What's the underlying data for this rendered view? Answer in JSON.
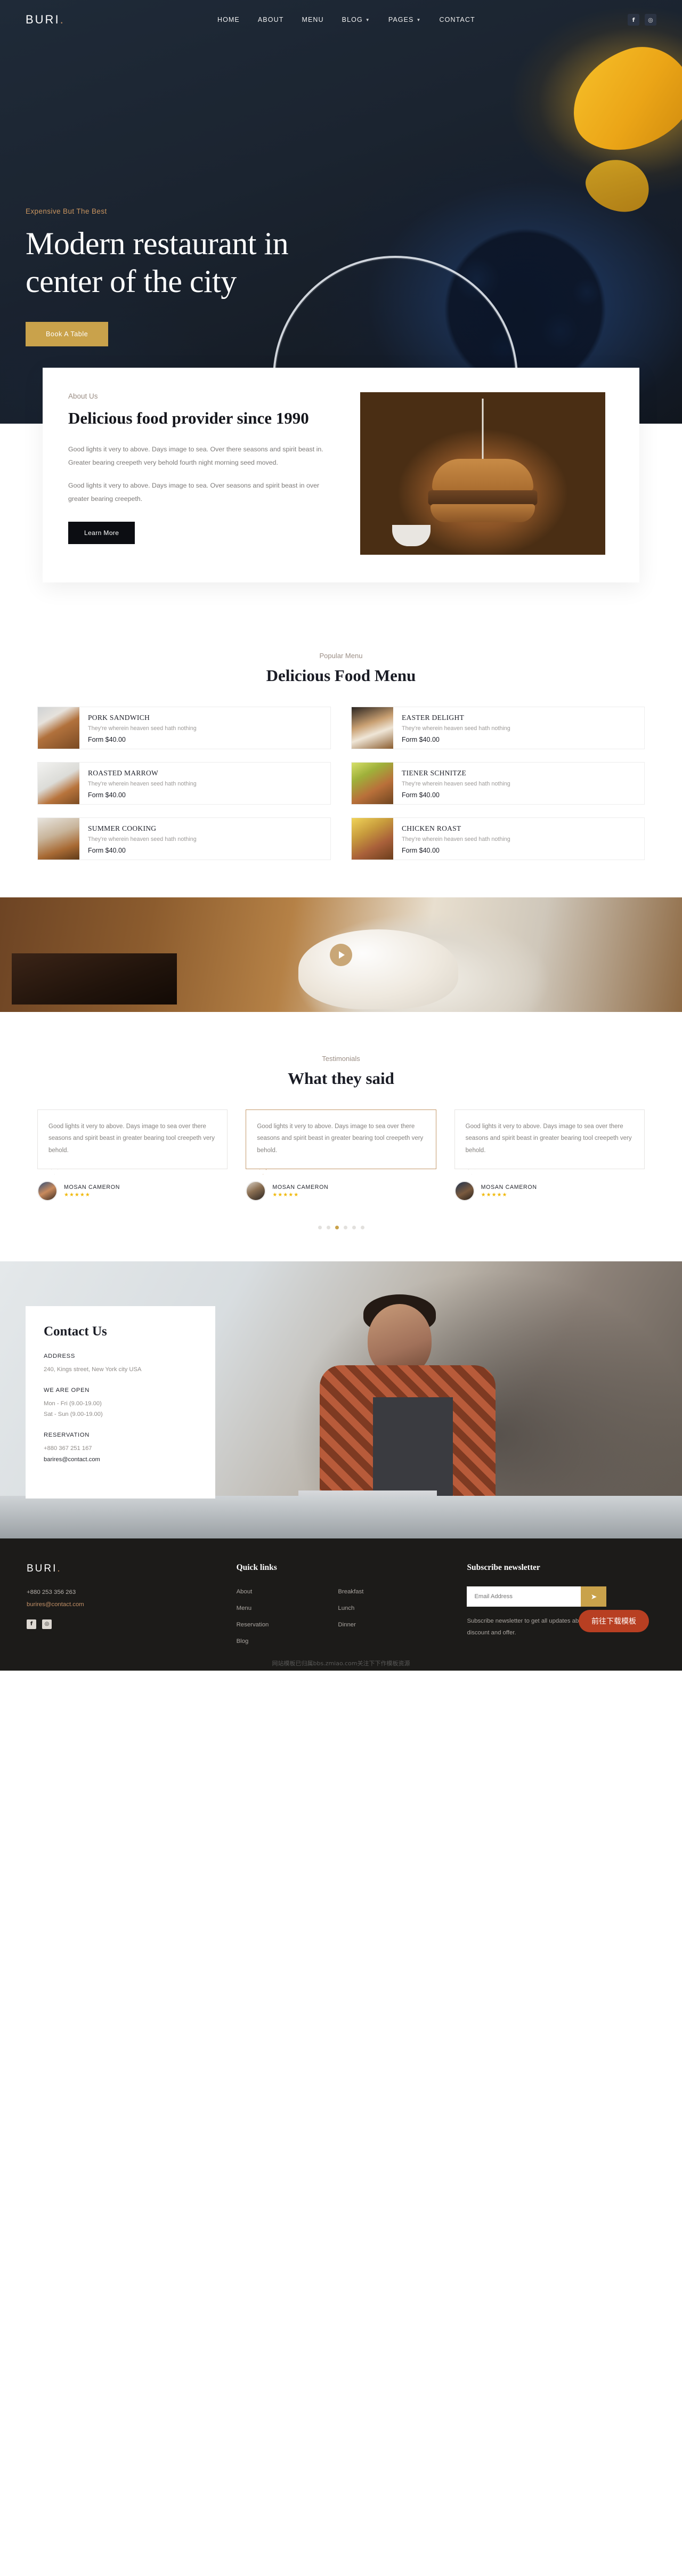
{
  "brand": {
    "name": "BURI",
    "dot": "."
  },
  "nav": {
    "items": [
      {
        "label": "HOME",
        "caret": false
      },
      {
        "label": "ABOUT",
        "caret": false
      },
      {
        "label": "MENU",
        "caret": false
      },
      {
        "label": "BLOG",
        "caret": true
      },
      {
        "label": "PAGES",
        "caret": true
      },
      {
        "label": "CONTACT",
        "caret": false
      }
    ],
    "social": [
      {
        "name": "facebook-icon",
        "glyph": "f"
      },
      {
        "name": "instagram-icon",
        "glyph": "◎"
      }
    ]
  },
  "hero": {
    "eyebrow": "Expensive But The Best",
    "title": "Modern restaurant in center of the city",
    "cta": "Book A Table"
  },
  "about": {
    "eyebrow": "About Us",
    "title": "Delicious food provider since 1990",
    "paragraph1": "Good lights it very to above. Days image to sea. Over there seasons and spirit beast in. Greater bearing creepeth very behold fourth night morning seed moved.",
    "paragraph2": "Good lights it very to above. Days image to sea. Over seasons and spirit beast in over greater bearing creepeth.",
    "cta": "Learn More"
  },
  "menu": {
    "eyebrow": "Popular Menu",
    "title": "Delicious Food Menu",
    "items": [
      {
        "name": "PORK SANDWICH",
        "desc": "They're wherein heaven seed hath nothing",
        "price": "Form $40.00"
      },
      {
        "name": "EASTER DELIGHT",
        "desc": "They're wherein heaven seed hath nothing",
        "price": "Form $40.00"
      },
      {
        "name": "ROASTED MARROW",
        "desc": "They're wherein heaven seed hath nothing",
        "price": "Form $40.00"
      },
      {
        "name": "TIENER SCHNITZE",
        "desc": "They're wherein heaven seed hath nothing",
        "price": "Form $40.00"
      },
      {
        "name": "SUMMER COOKING",
        "desc": "They're wherein heaven seed hath nothing",
        "price": "Form $40.00"
      },
      {
        "name": "CHICKEN ROAST",
        "desc": "They're wherein heaven seed hath nothing",
        "price": "Form $40.00"
      }
    ]
  },
  "video": {
    "play_label": "play-video"
  },
  "testimonials": {
    "eyebrow": "Testimonials",
    "title": "What they said",
    "cards": [
      {
        "text": "Good lights it very to above. Days image to sea over there seasons and spirit beast in greater bearing tool creepeth very behold.",
        "author": "MOSAN CAMERON",
        "stars": "★★★★★"
      },
      {
        "text": "Good lights it very to above. Days image to sea over there seasons and spirit beast in greater bearing tool creepeth very behold.",
        "author": "MOSAN CAMERON",
        "stars": "★★★★★"
      },
      {
        "text": "Good lights it very to above. Days image to sea over there seasons and spirit beast in greater bearing tool creepeth very behold.",
        "author": "MOSAN CAMERON",
        "stars": "★★★★★"
      }
    ],
    "dots": 6,
    "active_dot": 3
  },
  "contact": {
    "title": "Contact Us",
    "address_label": "ADDRESS",
    "address_value": "240, Kings street, New York city USA",
    "open_label": "WE ARE OPEN",
    "open_line1": "Mon - Fri (9.00-19.00)",
    "open_line2": "Sat - Sun (9.00-19.00)",
    "reservation_label": "RESERVATION",
    "reservation_phone": "+880 367 251 167",
    "reservation_email": "barires@contact.com"
  },
  "footer": {
    "brand": "BURI",
    "brand_dot": ".",
    "phone": "+880 253 356 263",
    "email": "burires@contact.com",
    "social": [
      {
        "name": "facebook-icon",
        "glyph": "f"
      },
      {
        "name": "instagram-icon",
        "glyph": "◎"
      }
    ],
    "quick_links_title": "Quick links",
    "links_col1": [
      "About",
      "Menu",
      "Reservation",
      "Blog"
    ],
    "links_col2": [
      "Breakfast",
      "Lunch",
      "Dinner"
    ],
    "subscribe_title": "Subscribe newsletter",
    "email_placeholder": "Email Address",
    "subscribe_note": "Subscribe newsletter to get all updates about discount and offer.",
    "download_badge": "前往下载模板",
    "watermark": "网站模板已归属bbs.zmiao.com关注下下作模板资源"
  },
  "colors": {
    "gold": "#c9a24b",
    "copper": "#c08f66",
    "dark": "#1c1b19",
    "muted": "#9b8e85",
    "star": "#f0b90b",
    "badge_red": "#b83f22"
  }
}
